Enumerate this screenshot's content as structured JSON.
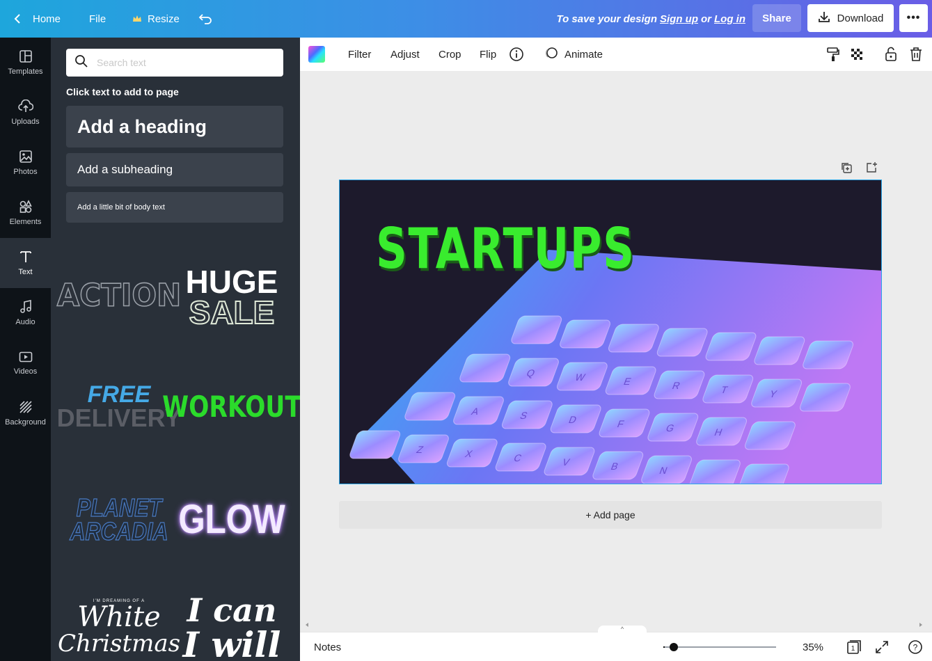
{
  "topbar": {
    "home": "Home",
    "file": "File",
    "resize": "Resize",
    "save_prefix": "To save your design",
    "sign_up": "Sign up",
    "or": "or",
    "log_in": "Log in",
    "share": "Share",
    "download": "Download",
    "more": "•••"
  },
  "rail": {
    "items": [
      {
        "label": "Templates",
        "icon": "templates-icon"
      },
      {
        "label": "Uploads",
        "icon": "upload-cloud-icon"
      },
      {
        "label": "Photos",
        "icon": "photo-icon"
      },
      {
        "label": "Elements",
        "icon": "shapes-icon"
      },
      {
        "label": "Text",
        "icon": "text-icon",
        "active": true
      },
      {
        "label": "Audio",
        "icon": "music-note-icon"
      },
      {
        "label": "Videos",
        "icon": "video-icon"
      },
      {
        "label": "Background",
        "icon": "background-pattern-icon"
      }
    ]
  },
  "panel": {
    "search_placeholder": "Search text",
    "hint": "Click text to add to page",
    "add_heading": "Add a heading",
    "add_subheading": "Add a subheading",
    "add_body": "Add a little bit of body text",
    "styles": {
      "action": "ACTION",
      "huge": "HUGE",
      "sale": "SALE",
      "free": "FREE",
      "delivery": "DELIVERY",
      "workout": "WORKOUT",
      "planet": "PLANET",
      "arcadia": "ARCADIA",
      "glow": "GLOW",
      "dreaming": "I'M DREAMING OF A",
      "white": "White",
      "christmas": "Christmas",
      "i_can": "I can",
      "i_will": "I will"
    }
  },
  "toolbar": {
    "filter": "Filter",
    "adjust": "Adjust",
    "crop": "Crop",
    "flip": "Flip",
    "animate": "Animate"
  },
  "canvas": {
    "heading_text": "STARTUPS",
    "add_page": "+ Add page",
    "keys": [
      "Q",
      "W",
      "E",
      "R",
      "T",
      "Y",
      "A",
      "S",
      "D",
      "F",
      "G",
      "H",
      "Z",
      "X",
      "C",
      "V",
      "B",
      "N"
    ]
  },
  "footer": {
    "notes": "Notes",
    "zoom": "35%",
    "page_count": "1",
    "help": "?"
  },
  "colors": {
    "topbar_start": "#1ea6dc",
    "topbar_end": "#6a5de6",
    "rail_bg": "#0e1318",
    "panel_bg": "#293039",
    "startups_green": "#39ec2e",
    "selection_blue": "#2aa6e8"
  }
}
